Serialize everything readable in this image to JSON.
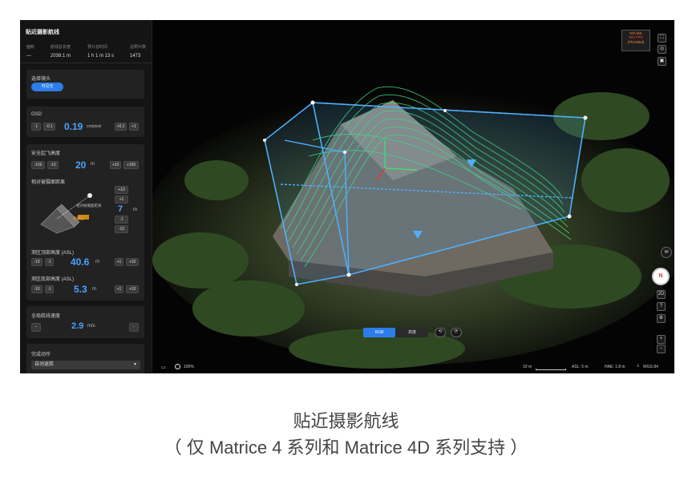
{
  "sidebar": {
    "title": "贴近摄影航线",
    "stats": [
      {
        "label": "面积",
        "value": "—"
      },
      {
        "label": "航线总长度",
        "value": "2038.1 m"
      },
      {
        "label": "预计总时间",
        "value": "1 h 1 m 13 s"
      },
      {
        "label": "总照片数",
        "value": "1473"
      }
    ],
    "lens": {
      "label": "选择镜头",
      "option": "可见光"
    },
    "gsd": {
      "label": "GSD",
      "value": "0.19",
      "unit": "cm/pixel",
      "dec2": "-1",
      "dec1": "-0.1",
      "inc1": "+0.1",
      "inc2": "+1"
    },
    "takeoff": {
      "label": "安全起飞高度",
      "value": "20",
      "unit": "m",
      "dec2": "-100",
      "dec1": "-10",
      "inc1": "+10",
      "inc2": "+100"
    },
    "distance": {
      "label": "相对被摄面距离",
      "diagram_text_1": "相对被摄面距离",
      "diagram_text_2": "被摄面",
      "value": "7",
      "unit": "m",
      "b1": "+10",
      "b2": "+1",
      "b3": "-1",
      "b4": "-10"
    },
    "top_alt": {
      "label": "测区顶部高度 (ASL)",
      "value": "40.6",
      "unit": "m",
      "dec2": "-10",
      "dec1": "-1",
      "inc1": "+1",
      "inc2": "+10"
    },
    "bottom_alt": {
      "label": "测区底部高度 (ASL)",
      "value": "5.3",
      "unit": "m",
      "dec2": "-10",
      "dec1": "-1",
      "inc1": "+1",
      "inc2": "+10"
    },
    "speed": {
      "label": "全局航线速度",
      "value": "2.9",
      "unit": "m/s",
      "dec": "−",
      "inc": "+"
    },
    "finish": {
      "label": "完成动作",
      "value": "自动返航"
    }
  },
  "scene": {
    "warn": {
      "line1": "N/A MS",
      "line2": "N/A FPS",
      "line3": "(Throttled)"
    },
    "modes": {
      "rgb": "RGB",
      "height": "高度"
    },
    "compass": "N",
    "view2d": "2D",
    "zoom_in": "+",
    "zoom_out": "−",
    "opacity": "100%",
    "scale": "10 m",
    "asl": "ASL: 5 m",
    "hae": "HAE: 1.8 m",
    "datum": "WGS 84",
    "colors": {
      "accent": "#2b7de9",
      "box": "#4fb0ff",
      "contour": "#3fdc7a"
    }
  },
  "caption": {
    "line1": "贴近摄影航线",
    "line2": "（ 仅 Matrice 4 系列和 Matrice 4D 系列支持 ）"
  }
}
